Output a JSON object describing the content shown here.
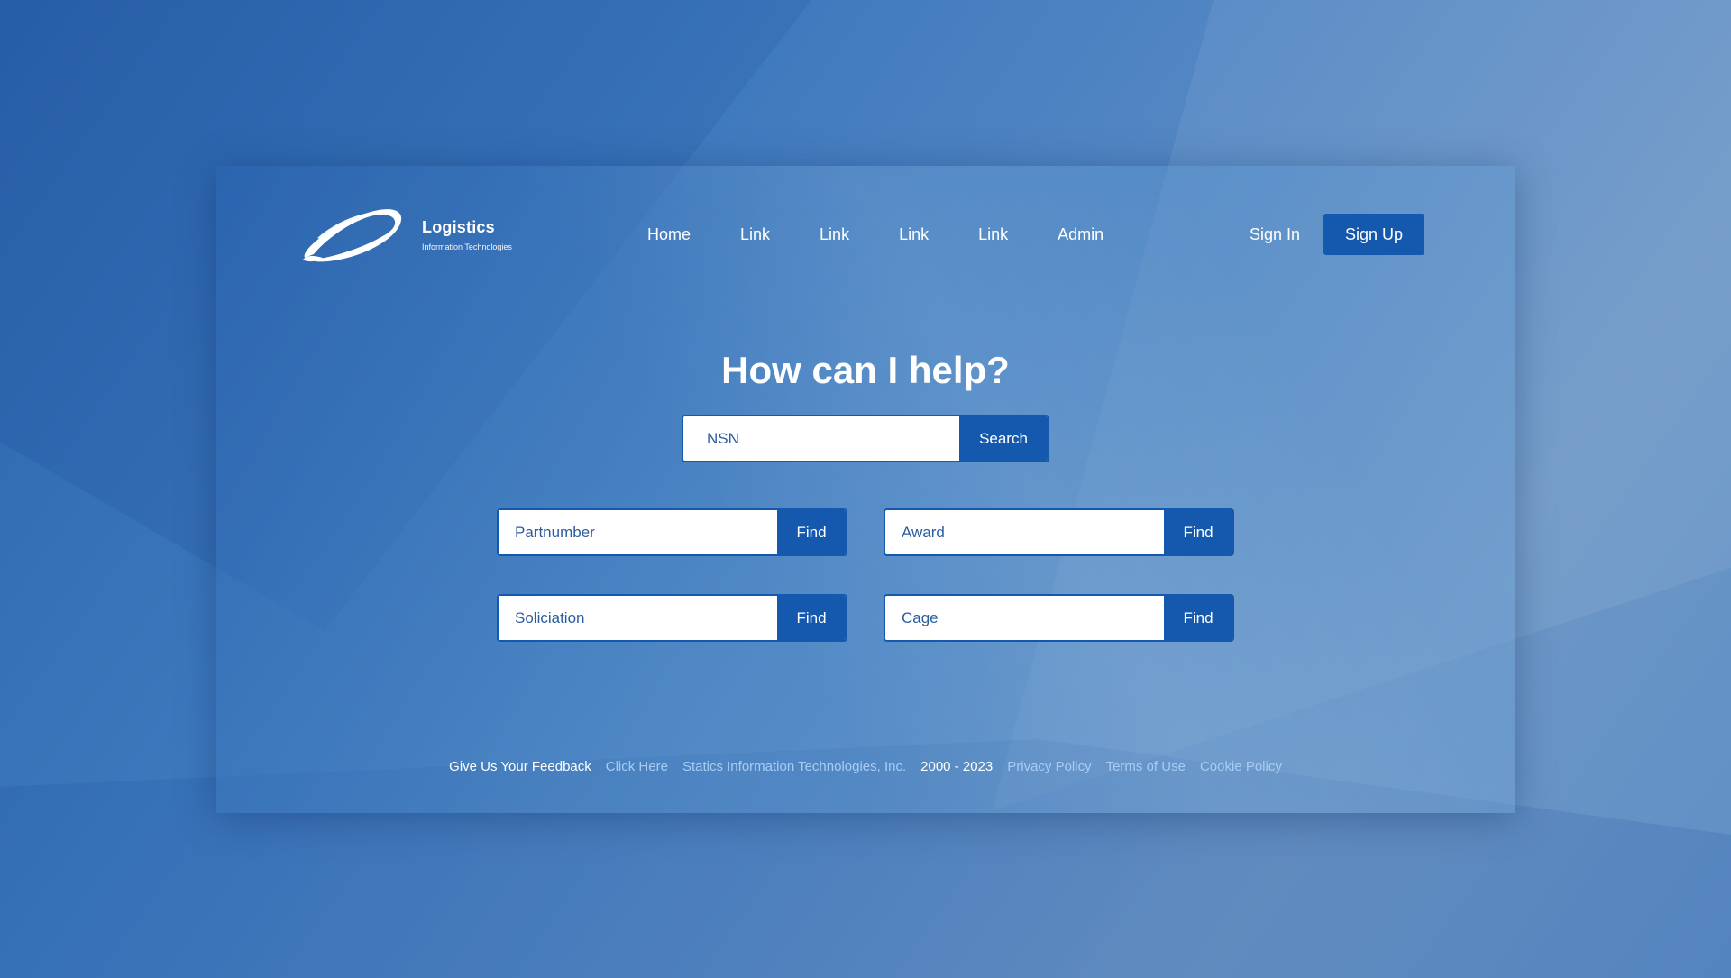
{
  "brand": {
    "title": "Logistics",
    "subtitle": "Information Technologies"
  },
  "nav": {
    "items": [
      {
        "label": "Home"
      },
      {
        "label": "Link"
      },
      {
        "label": "Link"
      },
      {
        "label": "Link"
      },
      {
        "label": "Link"
      },
      {
        "label": "Admin"
      }
    ]
  },
  "auth": {
    "sign_in": "Sign In",
    "sign_up": "Sign Up"
  },
  "hero": {
    "title": "How can I help?"
  },
  "search": {
    "nsn": {
      "placeholder": "NSN",
      "button": "Search"
    },
    "partnumber": {
      "placeholder": "Partnumber",
      "button": "Find"
    },
    "award": {
      "placeholder": "Award",
      "button": "Find"
    },
    "solicitation": {
      "placeholder": "Soliciation",
      "button": "Find"
    },
    "cage": {
      "placeholder": "Cage",
      "button": "Find"
    }
  },
  "footer": {
    "feedback_label": "Give Us Your Feedback",
    "feedback_link": "Click Here",
    "company": "Statics Information Technologies, Inc.",
    "years": "2000 - 2023",
    "privacy": "Privacy Policy",
    "terms": "Terms of Use",
    "cookie": "Cookie Policy"
  },
  "colors": {
    "primary": "#1459ad",
    "footer_link": "#a8cdf4",
    "input_text": "#2b5d9e"
  },
  "icons": {
    "logo": "swoosh-ring-logo-icon"
  }
}
